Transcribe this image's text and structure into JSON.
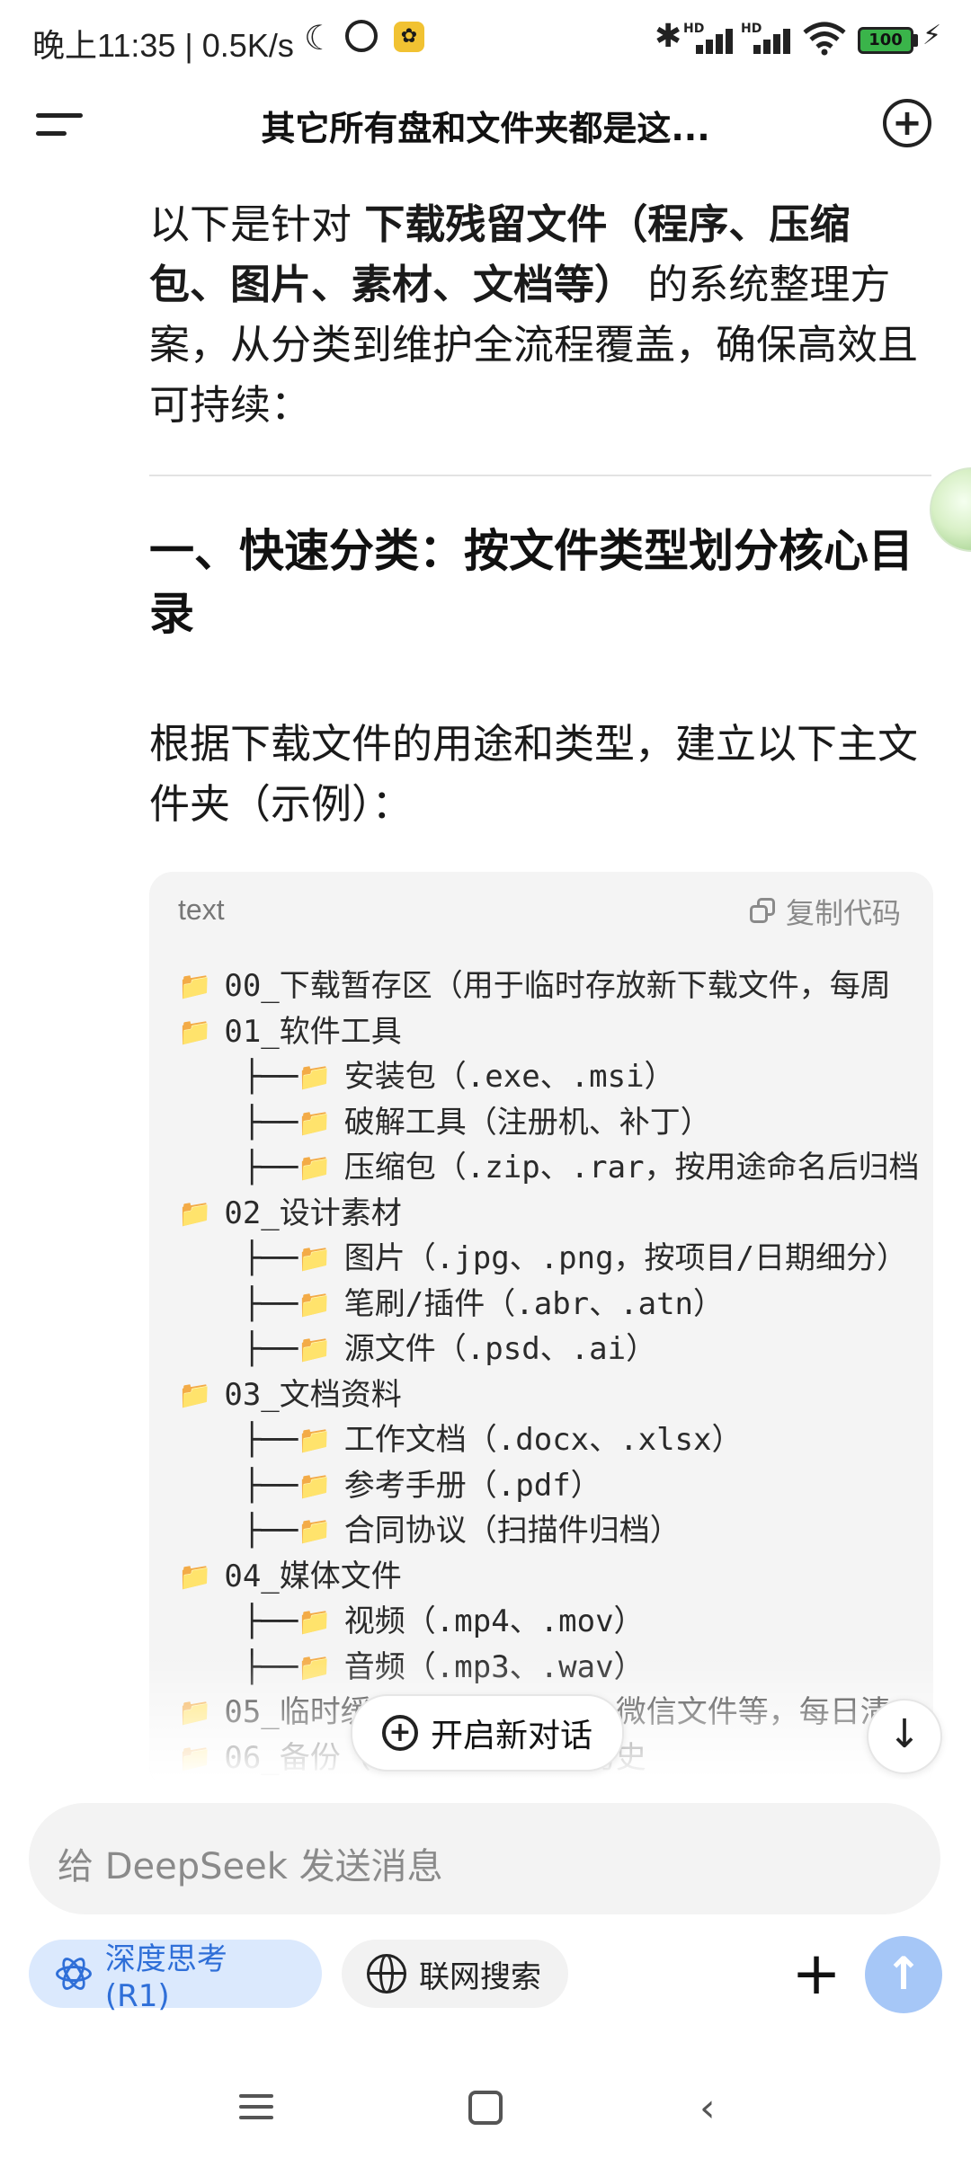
{
  "status_bar": {
    "time": "晚上11:35",
    "speed": "0.5K/s",
    "battery": "100",
    "hd": "HD"
  },
  "header": {
    "title": "其它所有盘和文件夹都是这..."
  },
  "content": {
    "intro_prefix": "以下是针对 ",
    "intro_bold": "下载残留文件（程序、压缩包、图片、素材、文档等）",
    "intro_suffix": " 的系统整理方案，从分类到维护全流程覆盖，确保高效且可持续：",
    "heading": "一、快速分类：按文件类型划分核心目录",
    "sub_para": "根据下载文件的用途和类型，建立以下主文件夹（示例）："
  },
  "code_block": {
    "language": "text",
    "copy_label": "复制代码",
    "lines": [
      {
        "indent": "",
        "text": "00_下载暂存区（用于临时存放新下载文件，每周"
      },
      {
        "indent": "",
        "text": "01_软件工具"
      },
      {
        "indent": "├──",
        "text": "安装包（.exe、.msi）"
      },
      {
        "indent": "├──",
        "text": "破解工具（注册机、补丁）"
      },
      {
        "indent": "├──",
        "text": "压缩包（.zip、.rar，按用途命名后归档"
      },
      {
        "indent": "",
        "text": "02_设计素材"
      },
      {
        "indent": "├──",
        "text": "图片（.jpg、.png，按项目/日期细分）"
      },
      {
        "indent": "├──",
        "text": "笔刷/插件（.abr、.atn）"
      },
      {
        "indent": "├──",
        "text": "源文件（.psd、.ai）"
      },
      {
        "indent": "",
        "text": "03_文档资料"
      },
      {
        "indent": "├──",
        "text": "工作文档（.docx、.xlsx）"
      },
      {
        "indent": "├──",
        "text": "参考手册（.pdf）"
      },
      {
        "indent": "├──",
        "text": "合同协议（扫描件归档）"
      },
      {
        "indent": "",
        "text": "04_媒体文件"
      },
      {
        "indent": "├──",
        "text": "视频（.mp4、.mov）"
      },
      {
        "indent": "├──",
        "text": "音频（.mp3、.wav）"
      },
      {
        "indent": "",
        "text": "05_临时缓存（浏览器下载、微信文件等，每日清"
      },
      {
        "indent": "",
        "text": "06_备份（项目的压缩包、历史"
      }
    ]
  },
  "floating": {
    "new_chat_label": "开启新对话"
  },
  "composer": {
    "placeholder": "给 DeepSeek 发送消息",
    "deep_think_label": "深度思考 (R1)",
    "web_search_label": "联网搜索"
  },
  "icons": {
    "folder": "📁",
    "accent_blue": "#2f6fd8"
  }
}
